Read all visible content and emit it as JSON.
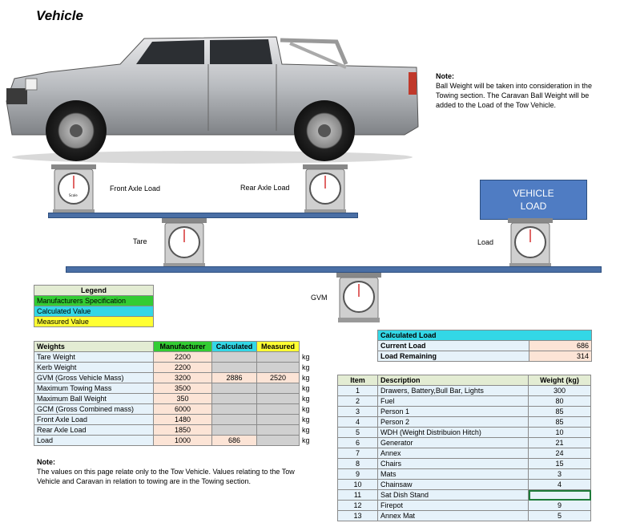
{
  "title": "Vehicle",
  "scale_labels": {
    "front_axle": "Front Axle Load",
    "rear_axle": "Rear Axle Load",
    "tare": "Tare",
    "load": "Load",
    "gvm": "GVM",
    "scale_brand": "Scale"
  },
  "note": {
    "heading": "Note:",
    "text": "Ball Weight will be taken into consideration in the Towing section.  The Caravan Ball Weight will be added to the Load of the Tow Vehicle."
  },
  "vehicle_load_box": {
    "line1": "VEHICLE",
    "line2": "LOAD"
  },
  "legend": {
    "title": "Legend",
    "items": [
      "Manufacturers Specification",
      "Calculated Value",
      "Measured Value"
    ]
  },
  "weights": {
    "headers": [
      "Weights",
      "Manufacturer",
      "Calculated",
      "Measured"
    ],
    "unit": "kg",
    "rows": [
      {
        "name": "Tare Weight",
        "manufacturer": "2200",
        "calculated": "",
        "measured": ""
      },
      {
        "name": "Kerb Weight",
        "manufacturer": "2200",
        "calculated": "",
        "measured": ""
      },
      {
        "name": "GVM (Gross Vehicle Mass)",
        "manufacturer": "3200",
        "calculated": "2886",
        "measured": "2520"
      },
      {
        "name": "Maximum Towing Mass",
        "manufacturer": "3500",
        "calculated": "",
        "measured": ""
      },
      {
        "name": "Maximum Ball Weight",
        "manufacturer": "350",
        "calculated": "",
        "measured": ""
      },
      {
        "name": "GCM (Gross Combined mass)",
        "manufacturer": "6000",
        "calculated": "",
        "measured": ""
      },
      {
        "name": "Front Axle Load",
        "manufacturer": "1480",
        "calculated": "",
        "measured": ""
      },
      {
        "name": "Rear Axle Load",
        "manufacturer": "1850",
        "calculated": "",
        "measured": ""
      },
      {
        "name": "Load",
        "manufacturer": "1000",
        "calculated": "686",
        "measured": ""
      }
    ]
  },
  "note2": {
    "heading": "Note:",
    "text": "The values on  this page relate only to the Tow Vehicle.  Values relating to the Tow Vehicle and Caravan in relation to towing are in the Towing section."
  },
  "calculated_load": {
    "title": "Calculated Load",
    "rows": [
      {
        "label": "Current Load",
        "value": "686"
      },
      {
        "label": "Load Remaining",
        "value": "314"
      }
    ]
  },
  "items": {
    "headers": [
      "Item",
      "Description",
      "Weight (kg)"
    ],
    "rows": [
      {
        "item": "1",
        "description": "Drawers, Battery,Bull Bar, Lights",
        "weight": "300"
      },
      {
        "item": "2",
        "description": "Fuel",
        "weight": "80"
      },
      {
        "item": "3",
        "description": "Person 1",
        "weight": "85"
      },
      {
        "item": "4",
        "description": "Person 2",
        "weight": "85"
      },
      {
        "item": "5",
        "description": "WDH (Weight Distribuion Hitch)",
        "weight": "10"
      },
      {
        "item": "6",
        "description": "Generator",
        "weight": "21"
      },
      {
        "item": "7",
        "description": "Annex",
        "weight": "24"
      },
      {
        "item": "8",
        "description": "Chairs",
        "weight": "15"
      },
      {
        "item": "9",
        "description": "Mats",
        "weight": "3"
      },
      {
        "item": "10",
        "description": "Chainsaw",
        "weight": "4"
      },
      {
        "item": "11",
        "description": "Sat Dish Stand",
        "weight": ""
      },
      {
        "item": "12",
        "description": "Firepot",
        "weight": "9"
      },
      {
        "item": "13",
        "description": "Annex Mat",
        "weight": "5"
      }
    ]
  },
  "colors": {
    "manufacturer": "#33cc33",
    "calculated": "#33d7e6",
    "measured": "#ffff33",
    "beam": "#4a6fa5",
    "vehicle_load_box": "#4f7cc3"
  }
}
